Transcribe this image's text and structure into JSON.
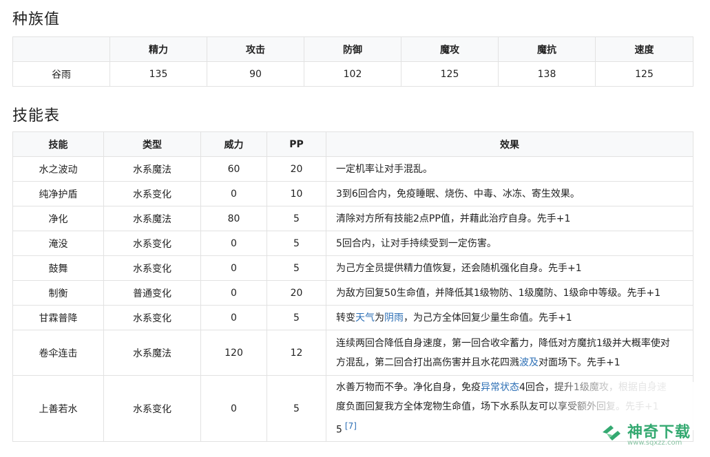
{
  "stats_title": "种族值",
  "stats": {
    "headers": [
      "",
      "精力",
      "攻击",
      "防御",
      "魔攻",
      "魔抗",
      "速度"
    ],
    "row": [
      "谷雨",
      "135",
      "90",
      "102",
      "125",
      "138",
      "125"
    ]
  },
  "skills_title": "技能表",
  "skills": {
    "headers": [
      "技能",
      "类型",
      "威力",
      "PP",
      "效果"
    ],
    "rows": [
      {
        "name": "水之波动",
        "type": "水系魔法",
        "power": "60",
        "pp": "20",
        "effect": "一定机率让对手混乱。"
      },
      {
        "name": "纯净护盾",
        "type": "水系变化",
        "power": "0",
        "pp": "10",
        "effect": "3到6回合内，免疫睡眠、烧伤、中毒、冰冻、寄生效果。"
      },
      {
        "name": "净化",
        "type": "水系魔法",
        "power": "80",
        "pp": "5",
        "effect": "清除对方所有技能2点PP值，并藉此治疗自身。先手+1"
      },
      {
        "name": "淹没",
        "type": "水系变化",
        "power": "0",
        "pp": "5",
        "effect": "5回合内，让对手持续受到一定伤害。"
      },
      {
        "name": "鼓舞",
        "type": "水系变化",
        "power": "0",
        "pp": "5",
        "effect": "为己方全员提供精力值恢复，还会随机强化自身。先手+1"
      },
      {
        "name": "制衡",
        "type": "普通变化",
        "power": "0",
        "pp": "20",
        "effect": "为敌方回复50生命值，并降低其1级物防、1级魔防、1级命中等级。先手+1"
      },
      {
        "name": "甘霖普降",
        "type": "水系变化",
        "power": "0",
        "pp": "5",
        "effect_a": "转变",
        "effect_link1": "天气",
        "effect_b": "为",
        "effect_link2": "阴雨",
        "effect_c": "，为己方全体回复少量生命值。先手+1"
      },
      {
        "name": "卷伞连击",
        "type": "水系魔法",
        "power": "120",
        "pp": "12",
        "effect_l1": "连续两回合降低自身速度，第一回合收伞蓄力，降低对方魔抗1级并大概率使对",
        "effect_l2a": "方混乱，第二回合打出高伤害并且水花四溅",
        "effect_link": "波及",
        "effect_l2b": "对面场下。先手+1"
      },
      {
        "name": "上善若水",
        "type": "水系变化",
        "power": "0",
        "pp": "5",
        "effect_l1a": "水善万物而不争。净化自身，免疫",
        "effect_link": "异常状态",
        "effect_l1b": "4回合，提升1级魔攻，根据自身速",
        "effect_l2": "度负面回复我方全体宠物生命值，场下水系队友可以享受额外回复。先手+1",
        "effect_l3": "5",
        "ref": "[7]"
      }
    ]
  },
  "watermark": {
    "text": "神奇下载",
    "url": "www.sqxzz.com"
  },
  "colors": {
    "header_bg": "#f8f9fa",
    "border": "#e2e2e2",
    "link": "#2d6fb5",
    "watermark": "#2aa56a"
  }
}
